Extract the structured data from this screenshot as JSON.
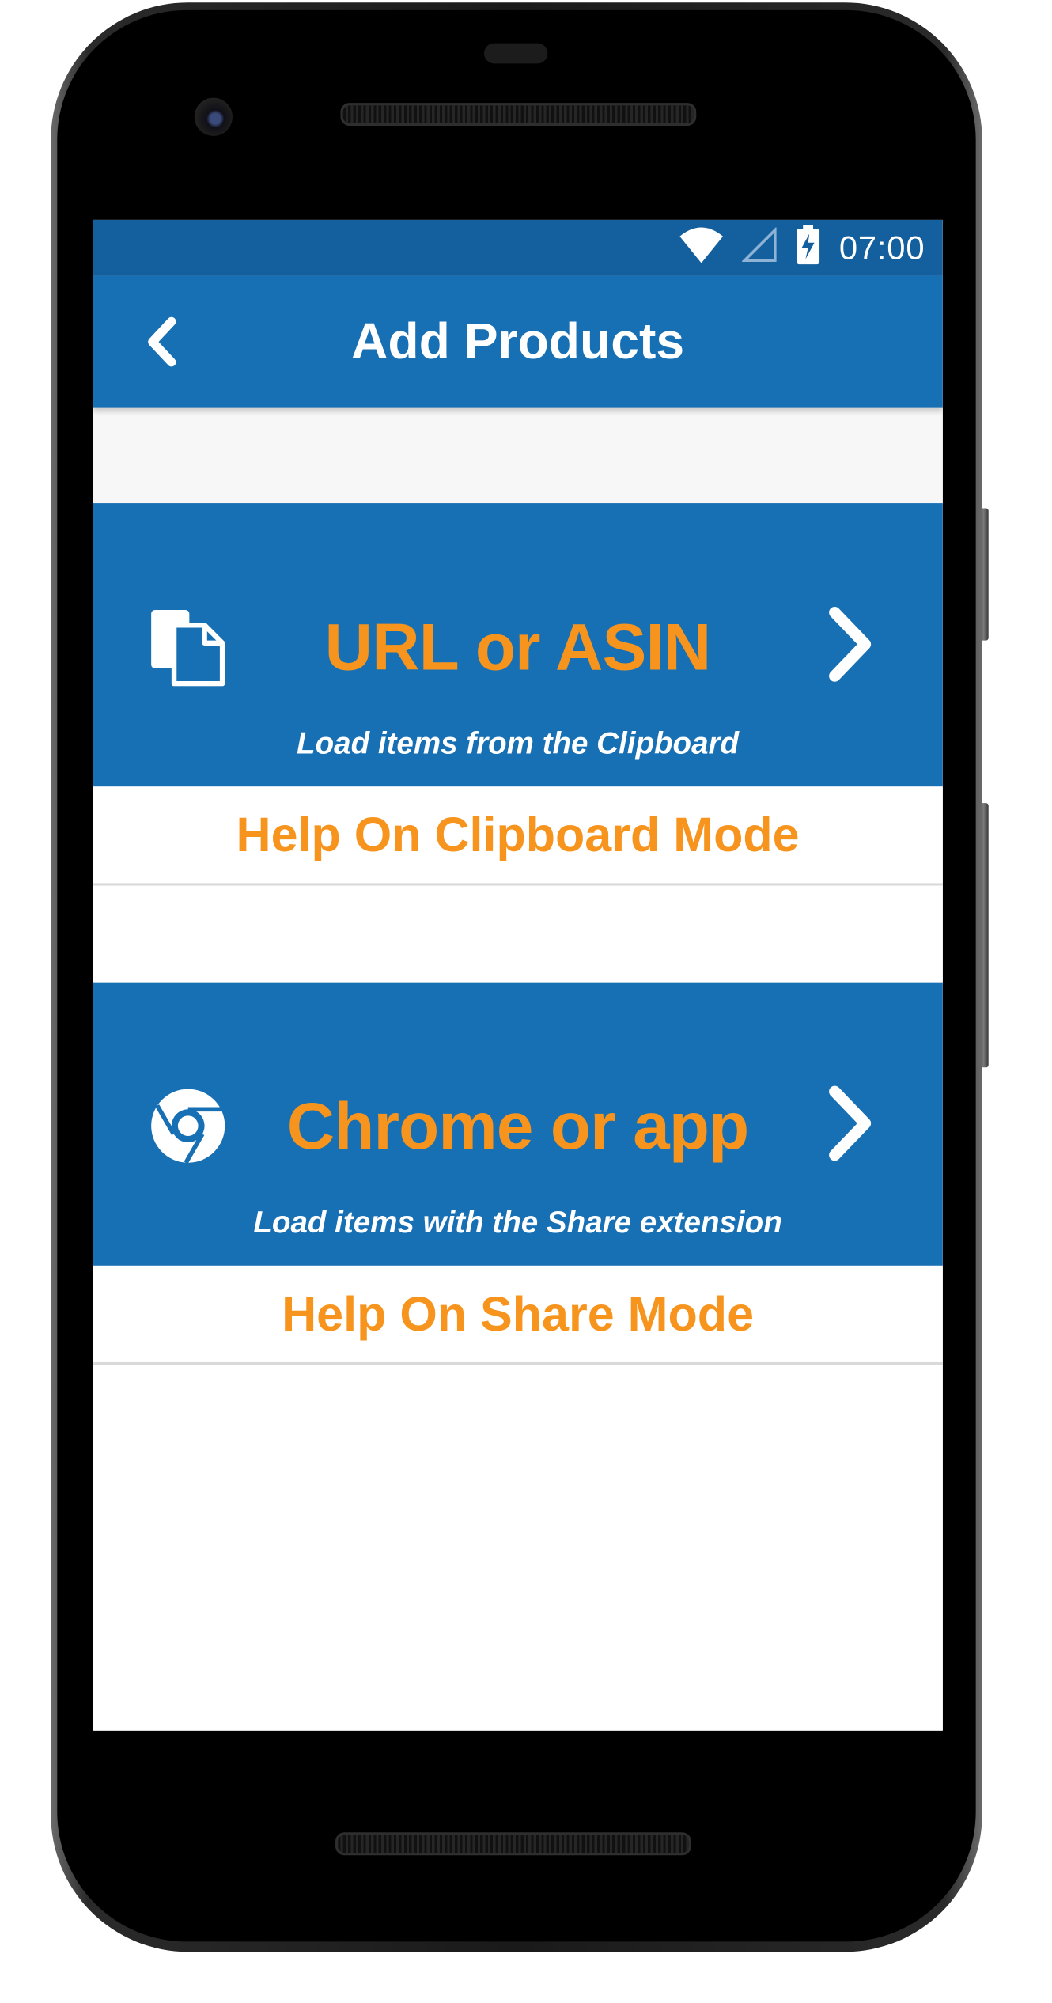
{
  "status_bar": {
    "time": "07:00",
    "icons": [
      "wifi-icon",
      "cell-signal-icon",
      "battery-charging-icon"
    ]
  },
  "app_bar": {
    "title": "Add Products",
    "back_icon": "chevron-left-icon"
  },
  "modes": [
    {
      "title": "URL or ASIN",
      "subtitle": "Load items from the Clipboard",
      "icon": "clipboard-copy-icon",
      "help_label": "Help On Clipboard Mode"
    },
    {
      "title": "Chrome or app",
      "subtitle": "Load items with the Share extension",
      "icon": "chrome-icon",
      "help_label": "Help On Share Mode"
    }
  ],
  "colors": {
    "status_bar": "#145f9d",
    "app_bar": "#176fb4",
    "accent_orange": "#f7941d",
    "text_white": "#ffffff"
  }
}
